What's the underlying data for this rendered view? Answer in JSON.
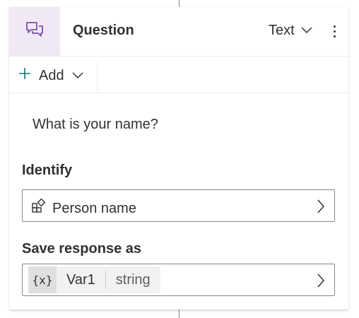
{
  "node": {
    "title": "Question",
    "type_label": "Text",
    "icon": "chat-bubbles-icon"
  },
  "toolbar": {
    "add_label": "Add"
  },
  "message": {
    "text": "What is your name?"
  },
  "identify": {
    "label": "Identify",
    "value": "Person name",
    "icon": "entity-shapes-icon"
  },
  "save_response": {
    "label": "Save response as",
    "var_icon": "{x}",
    "var_name": "Var1",
    "var_type": "string"
  },
  "colors": {
    "accent": "#7f4fa6",
    "icon_tile_bg": "#f0e9f5",
    "add_plus": "#0e7a7a"
  }
}
